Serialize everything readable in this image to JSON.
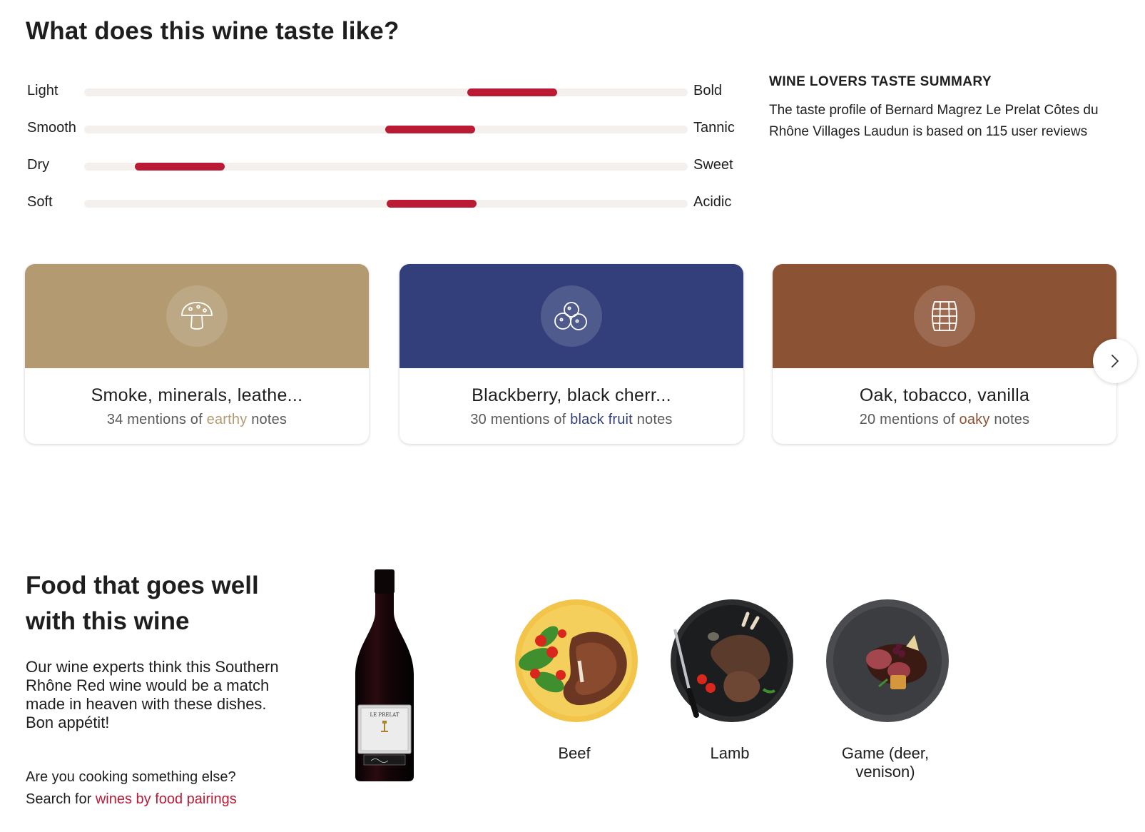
{
  "taste": {
    "heading": "What does this wine taste like?",
    "rows": [
      {
        "left": "Light",
        "right": "Bold",
        "position": 0.635
      },
      {
        "left": "Smooth",
        "right": "Tannic",
        "position": 0.499
      },
      {
        "left": "Dry",
        "right": "Sweet",
        "position": 0.084
      },
      {
        "left": "Soft",
        "right": "Acidic",
        "position": 0.501
      }
    ],
    "summary_title": "WINE LOVERS TASTE SUMMARY",
    "summary_text": "The taste profile of Bernard Magrez Le Prelat Côtes du Rhône Villages Laudun is based on 115 user reviews"
  },
  "flavors": {
    "cards": [
      {
        "title": "Smoke, minerals, leathe...",
        "count_text": "34 mentions of",
        "group": "earthy",
        "suffix": "notes",
        "color": "#b39a71",
        "icon": "mushroom-icon"
      },
      {
        "title": "Blackberry, black cherr...",
        "count_text": "30 mentions of",
        "group": "black fruit",
        "suffix": "notes",
        "color": "#333f7b",
        "icon": "berries-icon"
      },
      {
        "title": "Oak, tobacco, vanilla",
        "count_text": "20 mentions of",
        "group": "oaky",
        "suffix": "notes",
        "color": "#8b5234",
        "icon": "barrel-icon"
      }
    ],
    "next_icon": "chevron-right-icon"
  },
  "food": {
    "heading": "Food that goes well with this wine",
    "description": "Our wine experts think this Southern Rhône Red wine would be a match made in heaven with these dishes. Bon appétit!",
    "cook_line1": "Are you cooking something else?",
    "cook_line2_prefix": "Search for",
    "cook_link": "wines by food pairings",
    "bottle_label": "LE PRELAT",
    "dishes": [
      {
        "label": "Beef"
      },
      {
        "label": "Lamb"
      },
      {
        "label": "Game (deer, venison)"
      }
    ]
  },
  "colors": {
    "accent": "#ba1a34",
    "track": "#f3f0ee"
  }
}
